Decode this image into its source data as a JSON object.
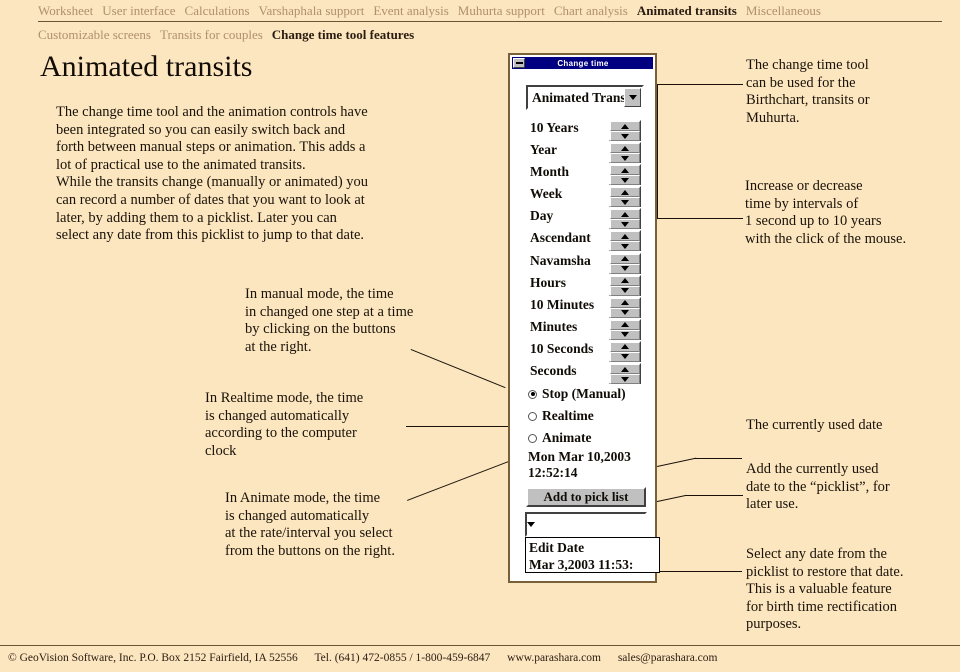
{
  "nav": {
    "row1": [
      {
        "label": "Worksheet",
        "active": false
      },
      {
        "label": "User interface",
        "active": false
      },
      {
        "label": "Calculations",
        "active": false
      },
      {
        "label": "Varshaphala support",
        "active": false
      },
      {
        "label": "Event analysis",
        "active": false
      },
      {
        "label": "Muhurta support",
        "active": false
      },
      {
        "label": "Chart analysis",
        "active": false
      },
      {
        "label": "Animated transits",
        "active": true
      },
      {
        "label": "Miscellaneous",
        "active": false
      }
    ],
    "row2": [
      {
        "label": "Customizable screens",
        "active": false
      },
      {
        "label": "Transits for couples",
        "active": false
      },
      {
        "label": "Change time tool features",
        "active": true
      }
    ]
  },
  "headline": "Animated transits",
  "body": {
    "intro": "The change time tool and the animation controls have\nbeen integrated so you can easily switch back and\nforth between manual steps or animation. This adds a\nlot of practical use to the animated transits.\nWhile the transits change (manually or animated) you\ncan record a number of dates that you want to look at\nlater, by adding them to a picklist. Later you can\nselect any date from this picklist to jump to that date.",
    "manual": "In manual mode, the time\nin changed one step at a time\nby clicking on the buttons\nat the right.",
    "realtime": "In Realtime mode, the time\nis changed automatically\naccording to the computer\nclock",
    "animate": "In Animate mode, the time\nis changed automatically\nat the rate/interval you select\nfrom the buttons on the right.",
    "tool_use": "The change time tool\ncan be used for the\nBirthchart, transits or\nMuhurta.",
    "interval": "Increase or decrease\ntime by intervals of\n1 second up to 10 years\nwith the click of the mouse.",
    "current_date": "The currently used date",
    "add_pick": "Add the currently used\ndate to the “picklist”, for\nlater use.",
    "select_date": "Select any date from the\npicklist to restore that date.\nThis is a valuable feature\nfor birth time rectification\npurposes."
  },
  "dialog": {
    "title": "Change time",
    "mode_combo_value": "Animated Trans",
    "step_rows": [
      {
        "label": "10 Years"
      },
      {
        "label": "Year"
      },
      {
        "label": "Month"
      },
      {
        "label": "Week"
      },
      {
        "label": "Day"
      },
      {
        "label": "Ascendant"
      },
      {
        "label": "Navamsha"
      },
      {
        "label": "Hours"
      },
      {
        "label": "10 Minutes"
      },
      {
        "label": "Minutes"
      },
      {
        "label": "10 Seconds"
      },
      {
        "label": "Seconds"
      }
    ],
    "modes": [
      {
        "label": "Stop (Manual)",
        "selected": true
      },
      {
        "label": "Realtime",
        "selected": false
      },
      {
        "label": "Animate",
        "selected": false
      }
    ],
    "current_datetime": "Mon Mar 10,2003\n12:52:14",
    "add_button_label": "Add to pick list",
    "picklist_combo_value": "",
    "picklist_items": [
      "Edit Date",
      "Mar 3,2003  11:53:"
    ]
  },
  "footer": {
    "copyright": "© GeoVision Software, Inc. P.O. Box 2152 Fairfield, IA 52556",
    "phone": "Tel. (641) 472-0855 / 1-800-459-6847",
    "website": "www.parashara.com",
    "email": "sales@parashara.com"
  },
  "colors": {
    "background": "#fce6c0",
    "nav_inactive": "#b0906c",
    "nav_active": "#2a1c10",
    "titlebar": "#000080",
    "face": "#c0c0c0"
  }
}
